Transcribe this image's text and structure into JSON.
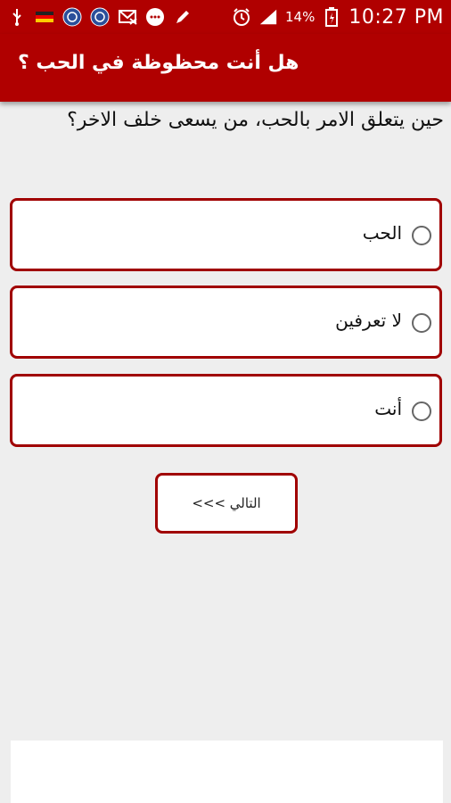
{
  "statusbar": {
    "left_icons": [
      "usb-icon",
      "flag-icon",
      "app-icon-1",
      "app-icon-2",
      "mail-blocked-icon",
      "chat-icon",
      "pen-icon"
    ],
    "battery": "14%",
    "time": "10:27 PM"
  },
  "appbar": {
    "title": "هل أنت محظوظة في الحب ؟"
  },
  "question": {
    "text": "حين يتعلق الامر بالحب، من يسعى خلف الاخر؟"
  },
  "options": [
    {
      "label": "الحب"
    },
    {
      "label": "لا تعرفين"
    },
    {
      "label": "أنت"
    }
  ],
  "next_button": {
    "label": "التالي >>>"
  },
  "colors": {
    "primary": "#b00000",
    "border": "#a00000",
    "background": "#eeeeee"
  }
}
